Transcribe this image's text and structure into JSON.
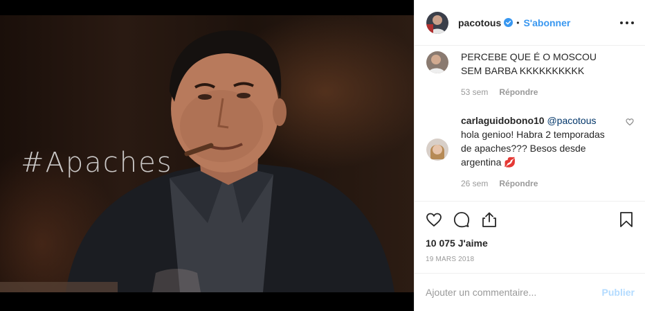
{
  "post": {
    "overlay_text": "#Apaches",
    "author": {
      "username": "pacotous",
      "verified": true,
      "dot": "•",
      "follow_label": "S'abonner"
    },
    "comments": [
      {
        "user": "",
        "mention": "",
        "text": "PERCEBE QUE É O MOSCOU SEM BARBA KKKKKKKKKK",
        "age": "53 sem",
        "reply_label": "Répondre"
      },
      {
        "user": "carlaguidobono10",
        "mention": "@pacotous",
        "text": "hola genioo! Habra 2 temporadas de apaches??? Besos desde argentina 💋",
        "age": "26 sem",
        "reply_label": "Répondre"
      }
    ],
    "likes_label": "10 075 J'aime",
    "date": "19 MARS 2018",
    "add_comment": {
      "placeholder": "Ajouter un commentaire...",
      "publish_label": "Publier"
    }
  },
  "colors": {
    "accent": "#3897f0",
    "publish_disabled": "#b3dbff",
    "muted": "#999999",
    "text": "#262626"
  }
}
